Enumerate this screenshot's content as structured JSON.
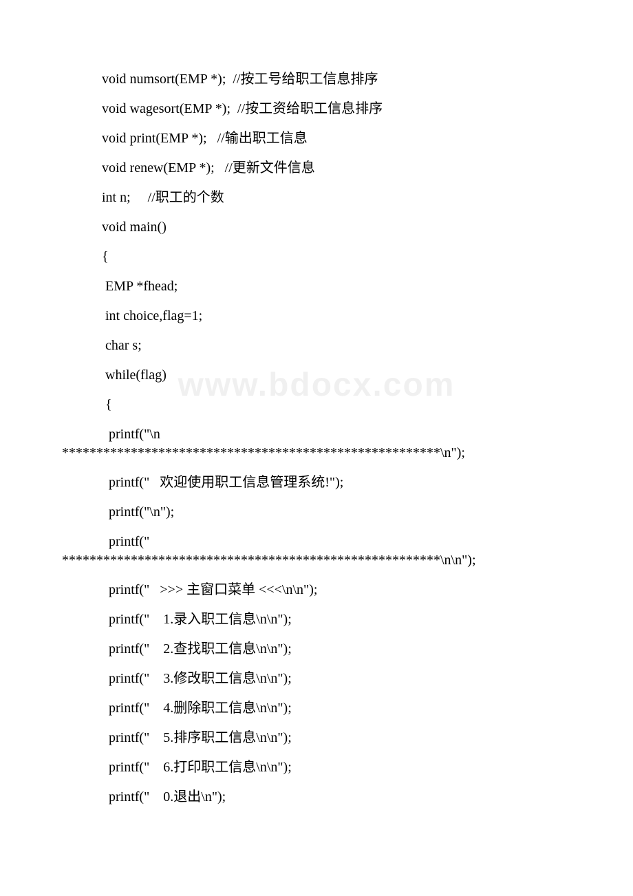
{
  "watermark": "www.bdocx.com",
  "lines": [
    {
      "cls": "line",
      "key": "l1"
    },
    {
      "cls": "line",
      "key": "l2"
    },
    {
      "cls": "line",
      "key": "l3"
    },
    {
      "cls": "line",
      "key": "l4"
    },
    {
      "cls": "line",
      "key": "l5"
    },
    {
      "cls": "line",
      "key": "l6"
    },
    {
      "cls": "line",
      "key": "l7"
    },
    {
      "cls": "line",
      "key": "l8"
    },
    {
      "cls": "line",
      "key": "l9"
    },
    {
      "cls": "line",
      "key": "l10"
    },
    {
      "cls": "line",
      "key": "l11"
    },
    {
      "cls": "line",
      "key": "l12"
    },
    {
      "cls": "line",
      "key": "l13"
    },
    {
      "cls": "line flush tight-top",
      "key": "l14"
    },
    {
      "cls": "line",
      "key": "l15"
    },
    {
      "cls": "line",
      "key": "l16"
    },
    {
      "cls": "line",
      "key": "l17"
    },
    {
      "cls": "line flush tight-top",
      "key": "l18"
    },
    {
      "cls": "line",
      "key": "l19"
    },
    {
      "cls": "line",
      "key": "l20"
    },
    {
      "cls": "line",
      "key": "l21"
    },
    {
      "cls": "line",
      "key": "l22"
    },
    {
      "cls": "line",
      "key": "l23"
    },
    {
      "cls": "line",
      "key": "l24"
    },
    {
      "cls": "line",
      "key": "l25"
    },
    {
      "cls": "line",
      "key": "l26"
    }
  ],
  "text": {
    "l1": "void numsort(EMP *);  //按工号给职工信息排序",
    "l2": "void wagesort(EMP *);  //按工资给职工信息排序",
    "l3": "void print(EMP *);   //输出职工信息",
    "l4": "void renew(EMP *);   //更新文件信息",
    "l5": "int n;     //职工的个数",
    "l6": "void main()",
    "l7": "{",
    "l8": " EMP *fhead;",
    "l9": " int choice,flag=1;",
    "l10": " char s;",
    "l11": " while(flag)",
    "l12": " {",
    "l13": "  printf(\"\\n     ",
    "l14": "*******************************************************\\n\");",
    "l15": "  printf(\"   欢迎使用职工信息管理系统!\");",
    "l16": "  printf(\"\\n\");",
    "l17": "  printf(\"     ",
    "l18": "*******************************************************\\n\\n\");",
    "l19": "  printf(\"   >>> 主窗口菜单 <<<\\n\\n\");",
    "l20": "  printf(\"    1.录入职工信息\\n\\n\");",
    "l21": "  printf(\"    2.查找职工信息\\n\\n\");",
    "l22": "  printf(\"    3.修改职工信息\\n\\n\");",
    "l23": "  printf(\"    4.删除职工信息\\n\\n\");",
    "l24": "  printf(\"    5.排序职工信息\\n\\n\");",
    "l25": "  printf(\"    6.打印职工信息\\n\\n\");",
    "l26": "  printf(\"    0.退出\\n\");"
  }
}
